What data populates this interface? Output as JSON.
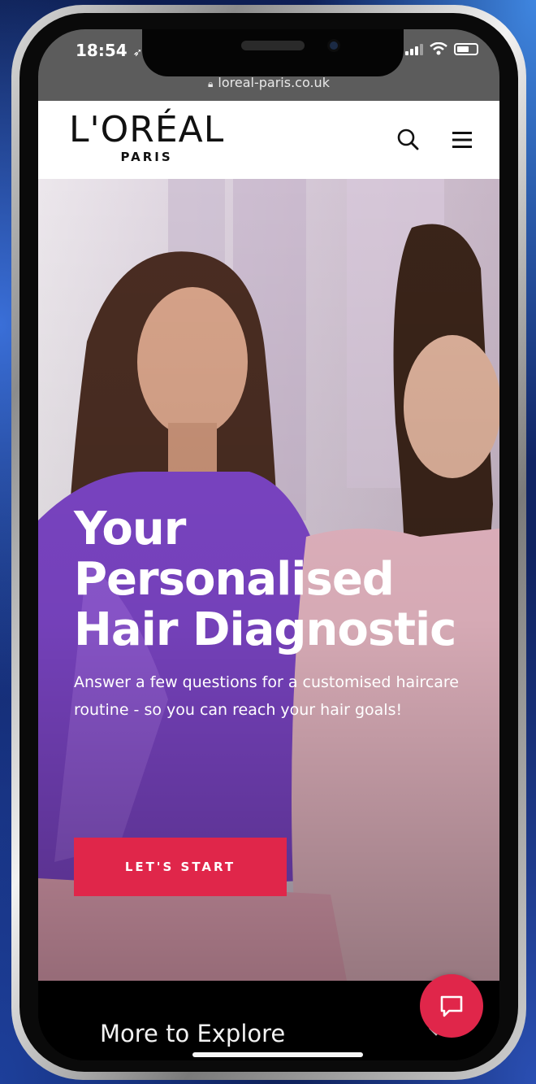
{
  "status_bar": {
    "time": "18:54"
  },
  "browser": {
    "url": "loreal-paris.co.uk"
  },
  "header": {
    "logo_main": "L'ORÉAL",
    "logo_sub": "PARIS"
  },
  "hero": {
    "title_lines": [
      "Your",
      "Personalised",
      "Hair Diagnostic"
    ],
    "subtitle": "Answer a few questions for a customised haircare routine - so you can reach your hair goals!",
    "cta_label": "LET'S START"
  },
  "footer": {
    "explore_label": "More to Explore"
  },
  "colors": {
    "accent": "#e0264a",
    "header_bg": "#ffffff",
    "footer_bg": "#000000"
  },
  "icons": [
    "search-icon",
    "menu-icon",
    "chat-icon",
    "chevron-down-icon",
    "lock-icon",
    "location-arrow-icon"
  ]
}
